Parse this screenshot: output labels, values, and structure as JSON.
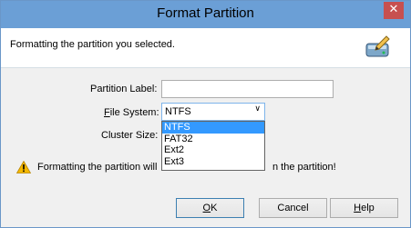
{
  "window": {
    "title": "Format Partition",
    "close_label": "✕"
  },
  "header": {
    "text": "Formatting the partition you selected.",
    "icon": "drive-edit-icon"
  },
  "form": {
    "partition_label": {
      "label": "Partition Label:",
      "value": ""
    },
    "file_system": {
      "label_prefix": "F",
      "label_rest": "ile System:",
      "value": "NTFS",
      "options": [
        "NTFS",
        "FAT32",
        "Ext2",
        "Ext3"
      ]
    },
    "cluster_size": {
      "label": "Cluster Size:"
    }
  },
  "warning": {
    "text_left": "Formatting the partition will",
    "text_right": "n the partition!",
    "icon": "warning-icon"
  },
  "buttons": {
    "ok": {
      "mnemonic": "O",
      "rest": "K"
    },
    "cancel": {
      "label": "Cancel"
    },
    "help": {
      "mnemonic": "H",
      "rest": "elp"
    }
  },
  "colors": {
    "titlebar": "#6b9fd6",
    "close": "#c75050",
    "selection": "#3399ff"
  }
}
